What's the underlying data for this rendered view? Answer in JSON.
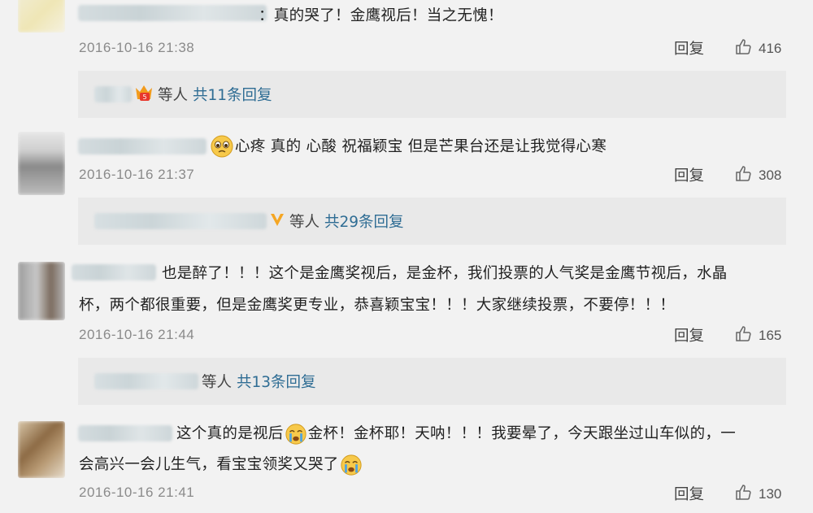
{
  "comments": [
    {
      "text_line1": "：真的哭了！金鹰视后！当之无愧！",
      "text_line2": "",
      "time": "2016-10-16 21:38",
      "reply_label": "回复",
      "likes": "416",
      "sub_replies": {
        "others": "等人",
        "link": "共11条回复"
      }
    },
    {
      "text_line1": "心疼 真的 心酸 祝福颖宝  但是芒果台还是让我觉得心寒",
      "text_line2": "",
      "time": "2016-10-16 21:37",
      "reply_label": "回复",
      "likes": "308",
      "sub_replies": {
        "others": "等人",
        "link": "共29条回复"
      }
    },
    {
      "text_line1": "也是醉了！！！这个是金鹰奖视后，是金杯，我们投票的人气奖是金鹰节视后，水晶",
      "text_line2": "杯，两个都很重要，但是金鹰奖更专业，恭喜颖宝宝！！！大家继续投票，不要停！！！",
      "time": "2016-10-16 21:44",
      "reply_label": "回复",
      "likes": "165",
      "sub_replies": {
        "others": "等人",
        "link": "共13条回复"
      }
    },
    {
      "text_line1a": "这个真的是视后",
      "text_line1b": "金杯！金杯耶！天呐！！！我要晕了，今天跟坐过山车似的，一",
      "text_line2": "会高兴一会儿生气，看宝宝领奖又哭了",
      "time": "2016-10-16 21:41",
      "reply_label": "回复",
      "likes": "130"
    }
  ],
  "icons": {
    "like": "thumbs-up-icon",
    "cry": "crying-face-icon",
    "sad": "pleading-face-icon",
    "vip": "vip-badge-icon",
    "verified": "verified-v-icon"
  },
  "colors": {
    "link": "#2f6d94",
    "time": "#8a8a8a",
    "background": "#f2f2f2",
    "sub_box": "#e9e9e9"
  }
}
